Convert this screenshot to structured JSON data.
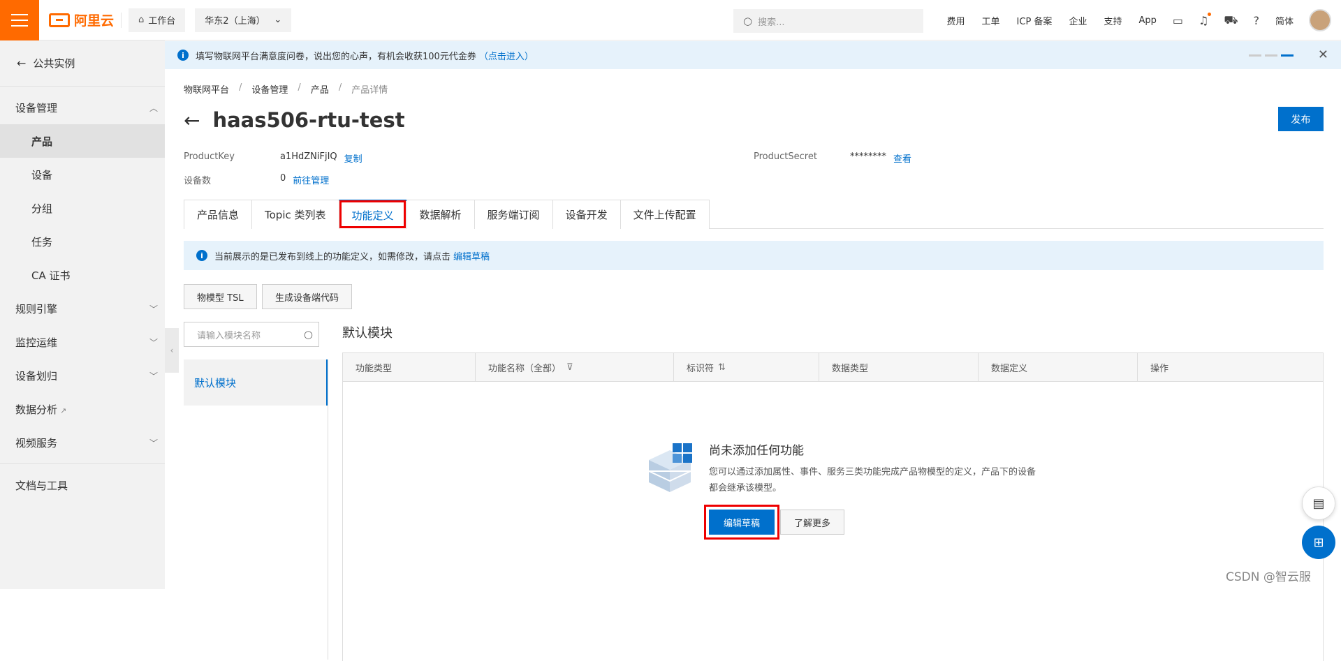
{
  "topbar": {
    "logo_text": "阿里云",
    "workbench": "工作台",
    "region": "华东2（上海）",
    "search_placeholder": "搜索...",
    "nav": [
      "费用",
      "工单",
      "ICP 备案",
      "企业",
      "支持",
      "App"
    ],
    "lang": "简体"
  },
  "notice": {
    "text": "填写物联网平台满意度问卷，说出您的心声，有机会收获100元代金券",
    "link": "（点击进入）"
  },
  "sidebar": {
    "back": "公共实例",
    "groups": [
      {
        "label": "设备管理",
        "subs": [
          "产品",
          "设备",
          "分组",
          "任务",
          "CA 证书"
        ],
        "active": "产品"
      },
      {
        "label": "规则引擎"
      },
      {
        "label": "监控运维"
      },
      {
        "label": "设备划归"
      },
      {
        "label": "数据分析"
      },
      {
        "label": "视频服务"
      }
    ],
    "docs": "文档与工具"
  },
  "breadcrumb": [
    "物联网平台",
    "设备管理",
    "产品",
    "产品详情"
  ],
  "page": {
    "title": "haas506-rtu-test",
    "publish": "发布",
    "product_key_label": "ProductKey",
    "product_key": "a1HdZNiFjIQ",
    "copy": "复制",
    "device_count_label": "设备数",
    "device_count": "0",
    "manage": "前往管理",
    "secret_label": "ProductSecret",
    "secret": "********",
    "view": "查看"
  },
  "tabs": [
    "产品信息",
    "Topic 类列表",
    "功能定义",
    "数据解析",
    "服务端订阅",
    "设备开发",
    "文件上传配置"
  ],
  "alert": {
    "text": "当前展示的是已发布到线上的功能定义，如需修改，请点击",
    "link": "编辑草稿"
  },
  "actions": {
    "tsl": "物模型 TSL",
    "gen_code": "生成设备端代码"
  },
  "modules": {
    "search_placeholder": "请输入模块名称",
    "items": [
      "默认模块"
    ],
    "title": "默认模块"
  },
  "table": {
    "headers": [
      "功能类型",
      "功能名称（全部）",
      "标识符",
      "数据类型",
      "数据定义",
      "操作"
    ]
  },
  "empty": {
    "title": "尚未添加任何功能",
    "desc": "您可以通过添加属性、事件、服务三类功能完成产品物模型的定义，产品下的设备都会继承该模型。",
    "edit": "编辑草稿",
    "more": "了解更多"
  },
  "watermark": "CSDN @智云服"
}
